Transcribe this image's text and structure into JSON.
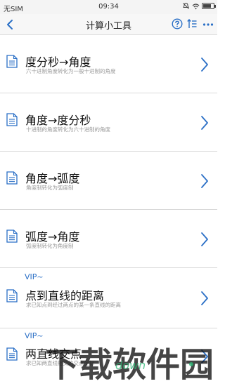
{
  "status_bar": {
    "carrier": "无SIM",
    "time": "09:34",
    "battery_level": 0.8
  },
  "nav": {
    "title": "计算小工具"
  },
  "items": [
    {
      "name": "度分秒→角度",
      "desc": "六十进制角度转化为一般十进制的角度",
      "vip": ""
    },
    {
      "name": "角度→度分秒",
      "desc": "十进制的角度转化为六十进制的角度",
      "vip": ""
    },
    {
      "name": "角度→弧度",
      "desc": "角度制转化为弧度制",
      "vip": ""
    },
    {
      "name": "弧度→角度",
      "desc": "弧度制转化为角度制",
      "vip": ""
    },
    {
      "name": "点到直线的距离",
      "desc": "求已知点到经过两点的某一条直线的距离",
      "vip": "VIP~"
    },
    {
      "name": "两直线交点",
      "desc": "求已知两直线相交的交点坐标",
      "vip": "VIP~"
    }
  ],
  "colors": {
    "accent": "#2a6fc6",
    "divider": "#d9d9d9",
    "watermark_green": "#2bb673"
  },
  "watermark": {
    "text": "下载软件园"
  }
}
